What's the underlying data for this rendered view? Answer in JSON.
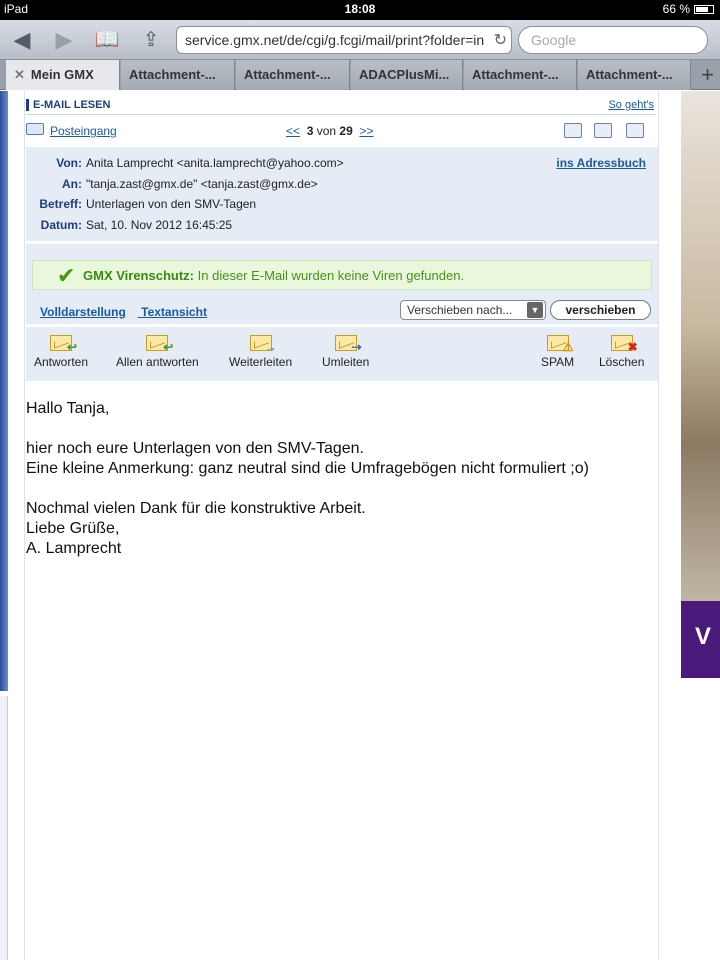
{
  "status_bar": {
    "device": "iPad",
    "time": "18:08",
    "battery": "66 %"
  },
  "browser": {
    "url": "service.gmx.net/de/cgi/g.fcgi/mail/print?folder=in",
    "search_placeholder": "Google",
    "tabs": [
      {
        "label": "Mein GMX",
        "active": true
      },
      {
        "label": "Attachment-..."
      },
      {
        "label": "Attachment-..."
      },
      {
        "label": "ADACPlusMi..."
      },
      {
        "label": "Attachment-..."
      },
      {
        "label": "Attachment-..."
      }
    ]
  },
  "mail": {
    "section_title": "E-MAIL LESEN",
    "help_link": "So geht's",
    "folder_link": "Posteingang",
    "pager": {
      "prev": "<<",
      "current": "3",
      "of_word": "von",
      "total": "29",
      "next": ">>"
    },
    "labels": {
      "from": "Von:",
      "to": "An:",
      "subject": "Betreff:",
      "date": "Datum:"
    },
    "from": "Anita Lamprecht <anita.lamprecht@yahoo.com>",
    "to": "\"tanja.zast@gmx.de\" <tanja.zast@gmx.de>",
    "subject": "Unterlagen von den SMV-Tagen",
    "date": "Sat, 10. Nov 2012 16:45:25",
    "address_book_link": "ins Adressbuch",
    "virus": {
      "brand": "GMX Virenschutz:",
      "message": "In dieser E-Mail wurden keine Viren gefunden."
    },
    "view_links": {
      "full": "Volldarstellung",
      "text": "Textansicht"
    },
    "move_select": "Verschieben nach...",
    "move_button": "verschieben",
    "actions": {
      "reply": "Antworten",
      "reply_all": "Allen antworten",
      "forward": "Weiterleiten",
      "redirect": "Umleiten",
      "spam": "SPAM",
      "delete": "Löschen"
    },
    "body": {
      "greeting": "Hallo Tanja,",
      "line1": "hier noch eure Unterlagen von den SMV-Tagen.",
      "line2": "Eine kleine Anmerkung: ganz neutral sind die Umfragebögen nicht formuliert ;o)",
      "line3": "Nochmal vielen Dank für die konstruktive Arbeit.",
      "closing": "Liebe Grüße,",
      "signature": "A. Lamprecht"
    }
  }
}
